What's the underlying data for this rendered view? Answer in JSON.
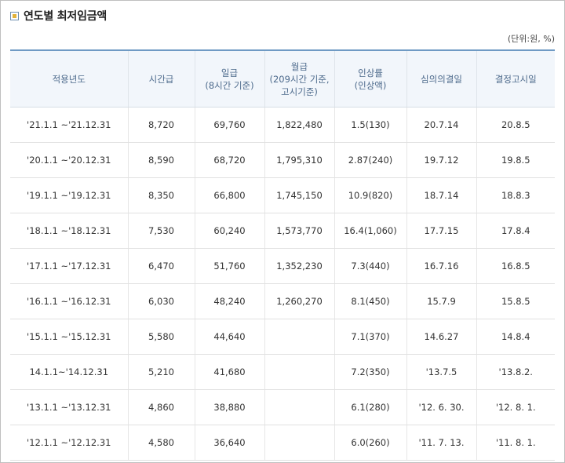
{
  "title": "연도별 최저임금액",
  "unit": "(단위:원, %)",
  "table": {
    "headers": [
      [
        "적용년도"
      ],
      [
        "시간급"
      ],
      [
        "일급",
        "(8시간 기준)"
      ],
      [
        "월급",
        "(209시간 기준,",
        "고시기준)"
      ],
      [
        "인상률",
        "(인상액)"
      ],
      [
        "심의의결일"
      ],
      [
        "결정고시일"
      ]
    ],
    "rows": [
      [
        "'21.1.1 ~'21.12.31",
        "8,720",
        "69,760",
        "1,822,480",
        "1.5(130)",
        "20.7.14",
        "20.8.5"
      ],
      [
        "'20.1.1 ~'20.12.31",
        "8,590",
        "68,720",
        "1,795,310",
        "2.87(240)",
        "19.7.12",
        "19.8.5"
      ],
      [
        "'19.1.1 ~'19.12.31",
        "8,350",
        "66,800",
        "1,745,150",
        "10.9(820)",
        "18.7.14",
        "18.8.3"
      ],
      [
        "'18.1.1 ~'18.12.31",
        "7,530",
        "60,240",
        "1,573,770",
        "16.4(1,060)",
        "17.7.15",
        "17.8.4"
      ],
      [
        "'17.1.1 ~'17.12.31",
        "6,470",
        "51,760",
        "1,352,230",
        "7.3(440)",
        "16.7.16",
        "16.8.5"
      ],
      [
        "'16.1.1 ~'16.12.31",
        "6,030",
        "48,240",
        "1,260,270",
        "8.1(450)",
        "15.7.9",
        "15.8.5"
      ],
      [
        "'15.1.1 ~'15.12.31",
        "5,580",
        "44,640",
        "",
        "7.1(370)",
        "14.6.27",
        "14.8.4"
      ],
      [
        "14.1.1~'14.12.31",
        "5,210",
        "41,680",
        "",
        "7.2(350)",
        "'13.7.5",
        "'13.8.2."
      ],
      [
        "'13.1.1 ~'13.12.31",
        "4,860",
        "38,880",
        "",
        "6.1(280)",
        "'12. 6. 30.",
        "'12. 8. 1."
      ],
      [
        "'12.1.1 ~'12.12.31",
        "4,580",
        "36,640",
        "",
        "6.0(260)",
        "'11. 7. 13.",
        "'11. 8. 1."
      ]
    ]
  }
}
